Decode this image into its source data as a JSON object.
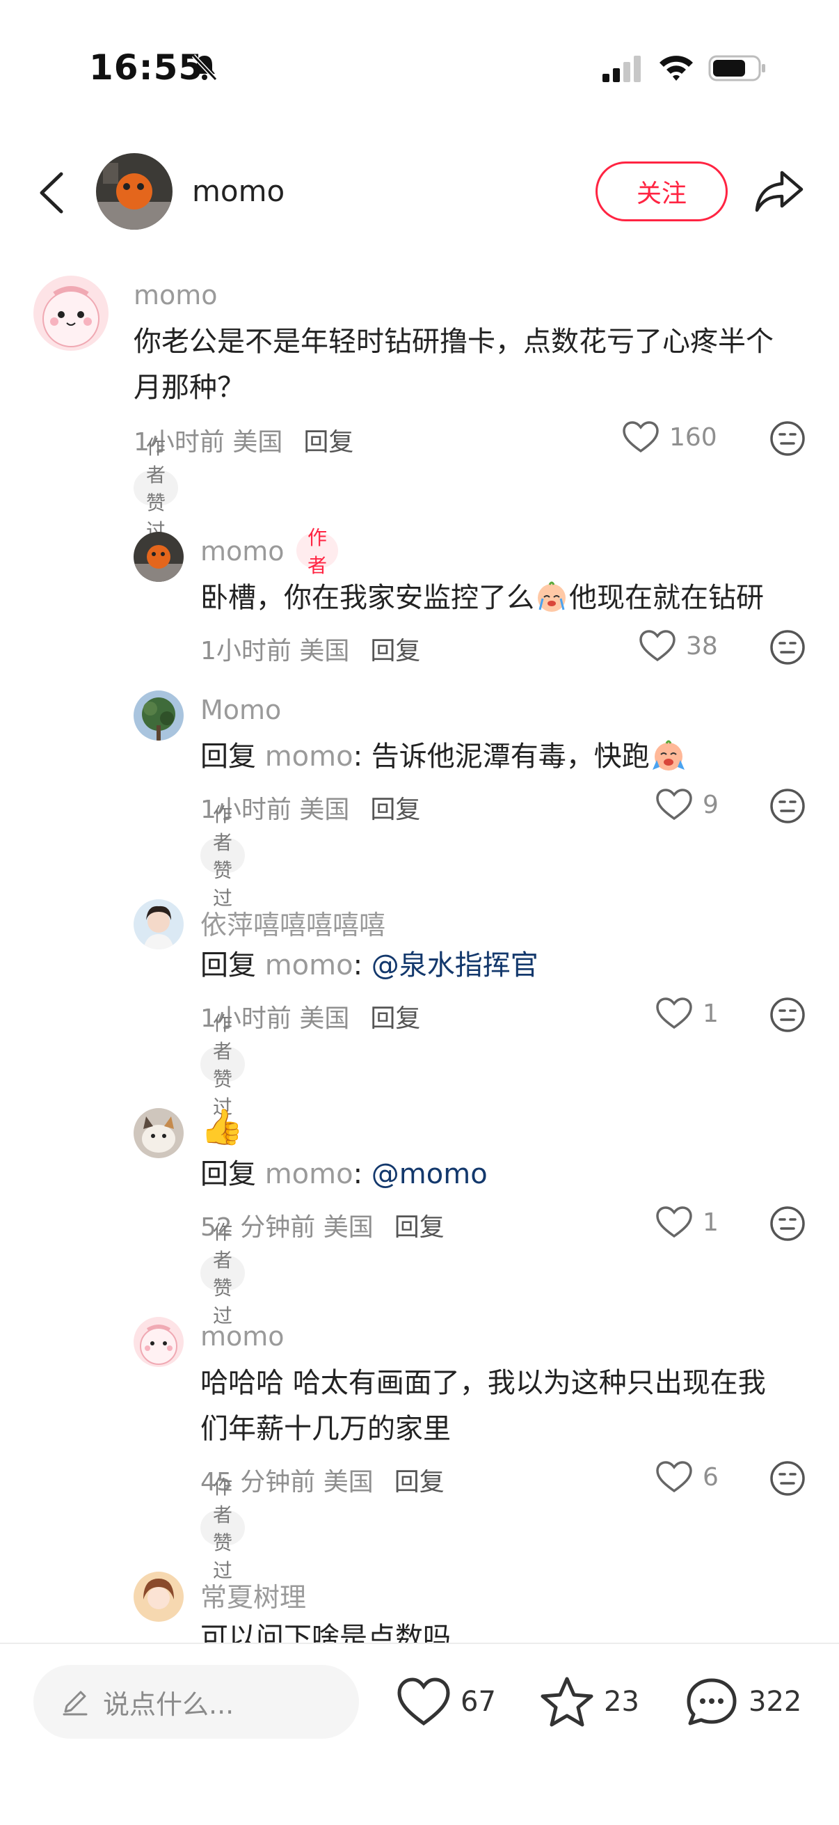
{
  "status": {
    "time": "16:55"
  },
  "header": {
    "name": "momo",
    "follow_label": "关注"
  },
  "comments": [
    {
      "name": "momo",
      "text_lines": [
        "你老公是不是年轻时钻研撸卡，点数花亏了心疼半个",
        "月那种？"
      ],
      "time_loc": "1小时前 美国",
      "reply_label": "回复",
      "likes": "160",
      "badge": "作者赞过"
    },
    {
      "name": "momo",
      "author_tag": "作者",
      "text_a": "卧槽，你在我家安监控了么",
      "text_b": "他现在就在钻研",
      "time_loc": "1小时前 美国",
      "reply_label": "回复",
      "likes": "38"
    },
    {
      "name": "Momo",
      "reply_prefix": "回复",
      "reply_to": "momo",
      "text": ": 告诉他泥潭有毒，快跑",
      "time_loc": "1小时前 美国",
      "reply_label": "回复",
      "likes": "9",
      "badge": "作者赞过"
    },
    {
      "name": "依萍嘻嘻嘻嘻嘻",
      "reply_prefix": "回复",
      "reply_to": "momo",
      "colon": ": ",
      "mention": "@泉水指挥官",
      "time_loc": "1小时前 美国",
      "reply_label": "回复",
      "likes": "1",
      "badge": "作者赞过"
    },
    {
      "name": "👍",
      "reply_prefix": "回复",
      "reply_to": "momo",
      "colon": ": ",
      "mention": "@momo",
      "time_loc": "52 分钟前 美国",
      "reply_label": "回复",
      "likes": "1",
      "badge": "作者赞过"
    },
    {
      "name": "momo",
      "text_lines": [
        "哈哈哈 哈太有画面了，我以为这种只出现在我",
        "们年薪十几万的家里"
      ],
      "time_loc": "45 分钟前 美国",
      "reply_label": "回复",
      "likes": "6",
      "badge": "作者赞过"
    },
    {
      "name": "常夏树理",
      "text": "可以问下啥是点数吗"
    }
  ],
  "bottom": {
    "input_placeholder": "说点什么...",
    "likes": "67",
    "favorites": "23",
    "comments": "322"
  },
  "colors": {
    "accent": "#ff2442",
    "mention": "#13386c",
    "muted": "#9a9a9a"
  }
}
